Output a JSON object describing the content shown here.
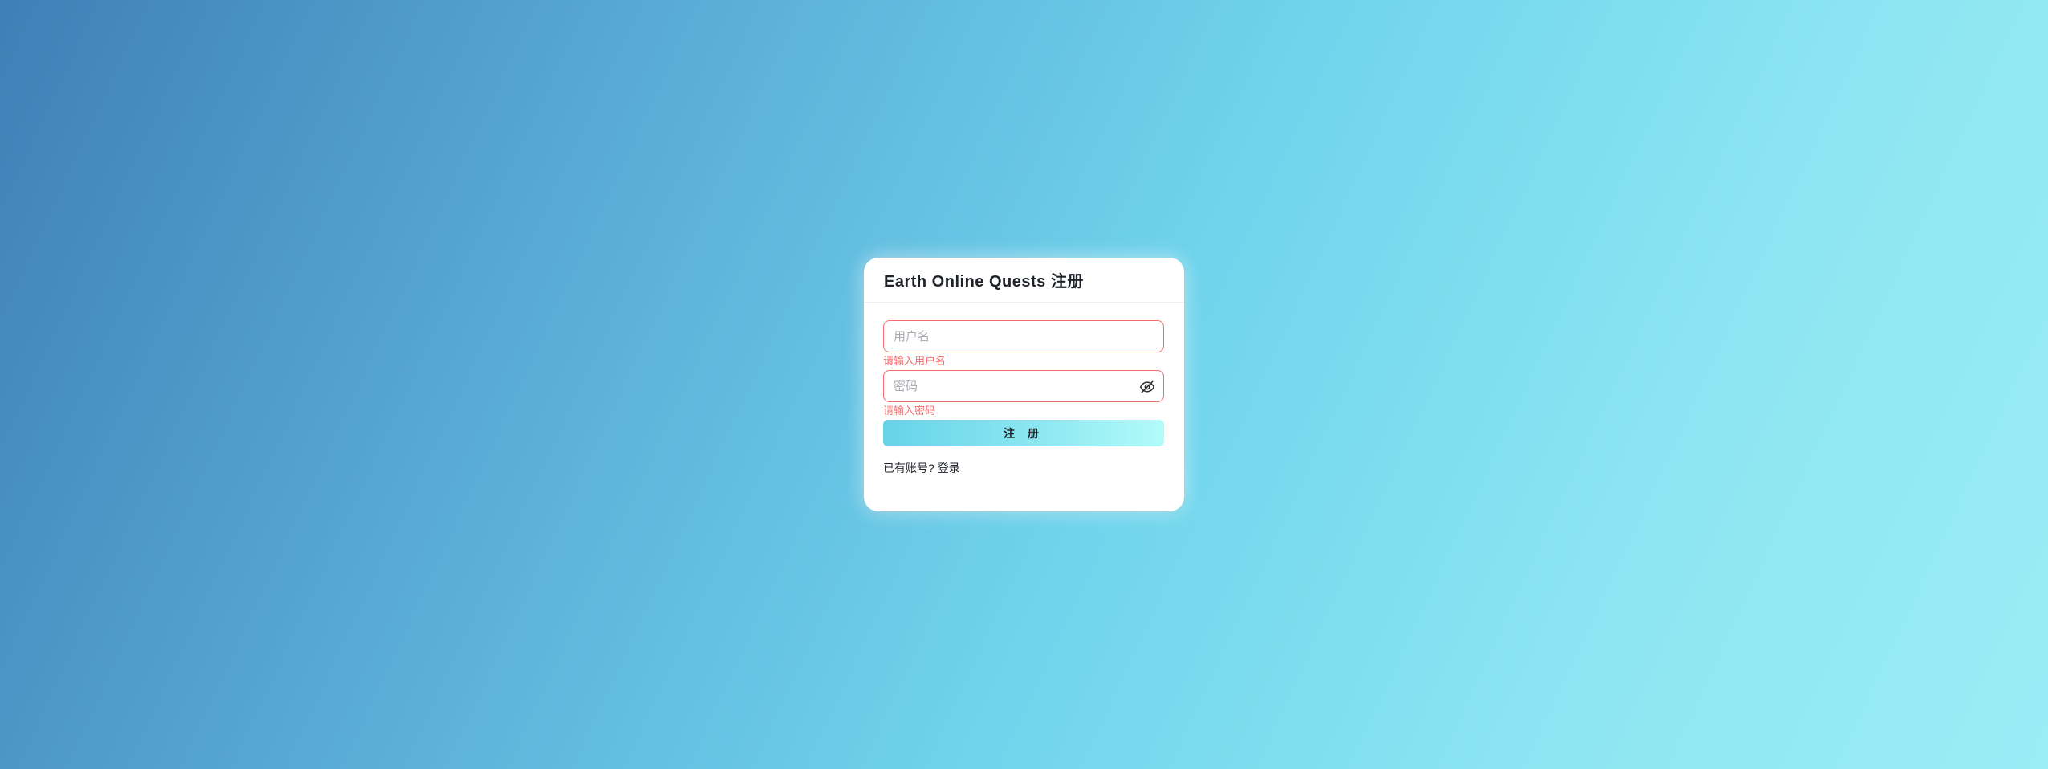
{
  "card": {
    "title": "Earth Online Quests 注册"
  },
  "form": {
    "username": {
      "placeholder": "用户名",
      "value": "",
      "error": "请输入用户名"
    },
    "password": {
      "placeholder": "密码",
      "value": "",
      "error": "请输入密码",
      "toggle_icon": "eye-off-icon"
    },
    "submit_label": "注 册"
  },
  "footer": {
    "prompt": "已有账号?",
    "login_link": "登录"
  },
  "colors": {
    "error": "#f56c6c",
    "button_gradient_start": "#66d3e8",
    "button_gradient_end": "#b2fbf9"
  }
}
